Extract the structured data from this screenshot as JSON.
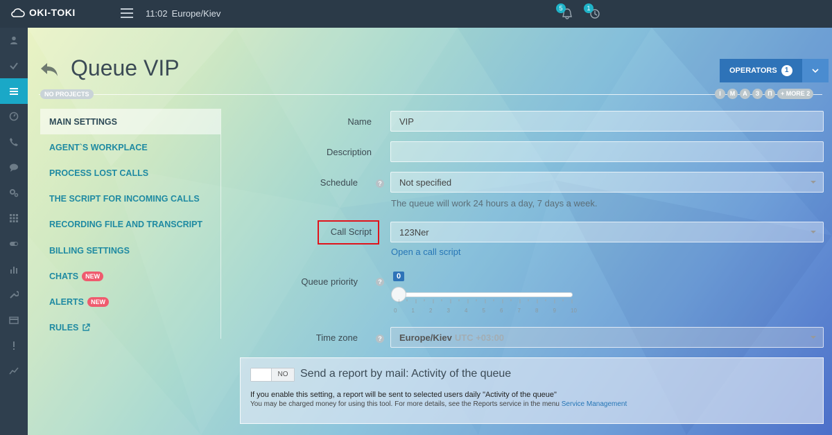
{
  "app": {
    "brand": "OKI-TOKI"
  },
  "topbar": {
    "time": "11:02",
    "timezone": "Europe/Kiev",
    "notifications_count": "5",
    "history_count": "1"
  },
  "page": {
    "title": "Queue VIP",
    "no_projects": "NO PROJECTS",
    "circles": [
      "I",
      "M",
      "A",
      "З",
      "П"
    ],
    "more": "+ MORE 2"
  },
  "operators": {
    "label": "OPERATORS",
    "count": "1"
  },
  "menu": {
    "items": [
      {
        "label": "MAIN SETTINGS"
      },
      {
        "label": "AGENT`S WORKPLACE"
      },
      {
        "label": "PROCESS LOST CALLS"
      },
      {
        "label": "THE SCRIPT FOR INCOMING CALLS"
      },
      {
        "label": "RECORDING FILE AND TRANSCRIPT"
      },
      {
        "label": "BILLING SETTINGS"
      },
      {
        "label": "CHATS",
        "badge": "NEW"
      },
      {
        "label": "ALERTS",
        "badge": "NEW"
      },
      {
        "label": "RULES"
      }
    ]
  },
  "form": {
    "name_label": "Name",
    "name_value": "VIP",
    "description_label": "Description",
    "description_value": "",
    "schedule_label": "Schedule",
    "schedule_value": "Not specified",
    "schedule_hint": "The queue will work 24 hours a day, 7 days a week.",
    "call_script_label": "Call Script",
    "call_script_value": "123Ner",
    "open_call_script": "Open a call script",
    "priority_label": "Queue priority",
    "priority_value": "0",
    "priority_ticks": [
      "0",
      "1",
      "2",
      "3",
      "4",
      "5",
      "6",
      "7",
      "8",
      "9",
      "10"
    ],
    "timezone_label": "Time zone",
    "timezone_value": "Europe/Kiev",
    "timezone_offset": "UTC +03:00"
  },
  "report": {
    "toggle_label": "NO",
    "title": "Send a report by mail: Activity of the queue",
    "text1": "If you enable this setting, a report will be sent to selected users daily \"Activity of the queue\"",
    "text2": "You may be charged money for using this tool. For more details, see the Reports service in the menu",
    "service_link": "Service Management"
  }
}
